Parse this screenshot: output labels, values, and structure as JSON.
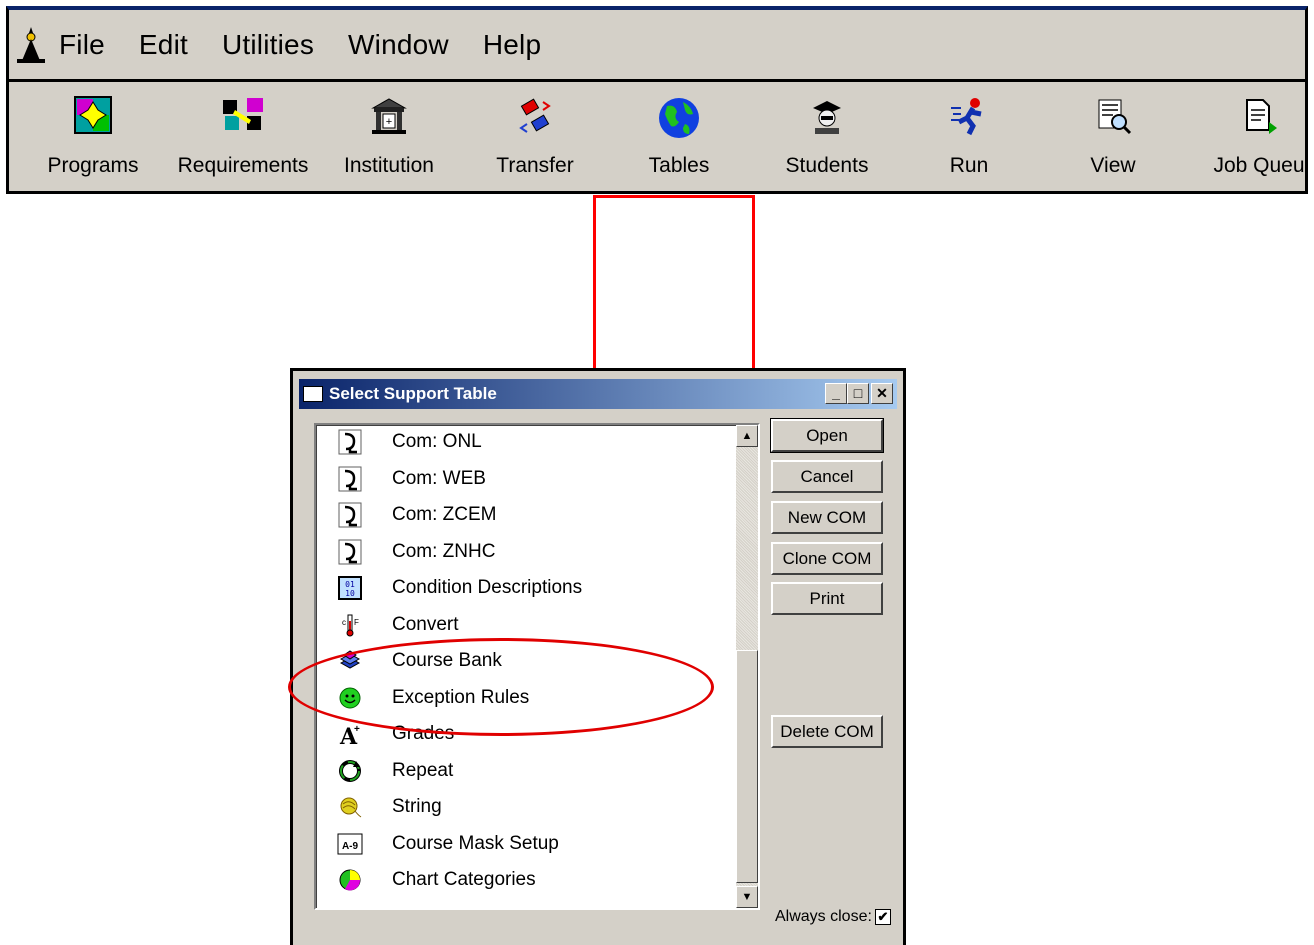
{
  "menubar": {
    "items": [
      "File",
      "Edit",
      "Utilities",
      "Window",
      "Help"
    ]
  },
  "toolbar": {
    "buttons": [
      {
        "label": "Programs",
        "icon": "programs-icon"
      },
      {
        "label": "Requirements",
        "icon": "requirements-icon"
      },
      {
        "label": "Institution",
        "icon": "institution-icon"
      },
      {
        "label": "Transfer",
        "icon": "transfer-icon"
      },
      {
        "label": "Tables",
        "icon": "globe-icon"
      },
      {
        "label": "Students",
        "icon": "student-icon"
      },
      {
        "label": "Run",
        "icon": "runner-icon"
      },
      {
        "label": "View",
        "icon": "view-icon"
      },
      {
        "label": "Job Queu",
        "icon": "job-queue-icon"
      }
    ]
  },
  "dialog": {
    "title": "Select Support Table",
    "items": [
      {
        "label": "Com:  ONL",
        "icon": "com-icon"
      },
      {
        "label": "Com:  WEB",
        "icon": "com-icon"
      },
      {
        "label": "Com:  ZCEM",
        "icon": "com-icon"
      },
      {
        "label": "Com:  ZNHC",
        "icon": "com-icon"
      },
      {
        "label": "Condition Descriptions",
        "icon": "condition-icon"
      },
      {
        "label": "Convert",
        "icon": "convert-icon"
      },
      {
        "label": "Course Bank",
        "icon": "books-icon"
      },
      {
        "label": "Exception Rules",
        "icon": "smiley-icon"
      },
      {
        "label": "Grades",
        "icon": "grade-icon"
      },
      {
        "label": "Repeat",
        "icon": "repeat-icon"
      },
      {
        "label": "String",
        "icon": "string-icon"
      },
      {
        "label": "Course Mask Setup",
        "icon": "mask-icon"
      },
      {
        "label": "Chart Categories",
        "icon": "pie-icon"
      }
    ],
    "buttons": {
      "open": "Open",
      "cancel": "Cancel",
      "new_com": "New COM",
      "clone_com": "Clone COM",
      "print": "Print",
      "delete_com": "Delete COM"
    },
    "always_close_label": "Always close:",
    "always_close_checked": true
  },
  "colors": {
    "highlight": "#ff0000",
    "titlebar": "#0a246a",
    "window_bg": "#d4d0c8"
  }
}
